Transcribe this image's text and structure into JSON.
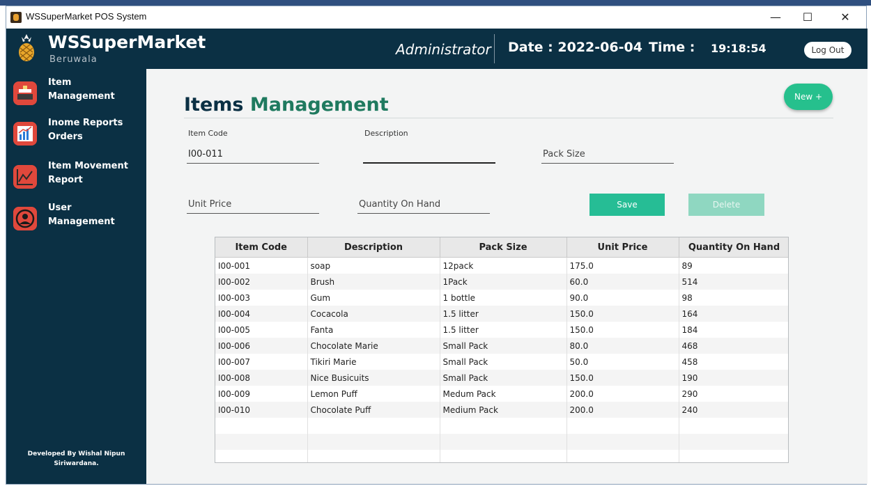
{
  "window": {
    "title": "WSSuperMarket POS System",
    "minimize": "—",
    "maximize": "☐",
    "close": "✕"
  },
  "header": {
    "brand": "WSSuperMarket",
    "branch": "Beruwala",
    "role": "Administrator",
    "date_label": "Date : 2022-06-04",
    "time_label": "Time :",
    "time_value": "19:18:54",
    "logout_label": "Log Out"
  },
  "sidebar": {
    "items": [
      {
        "line1": "Item",
        "line2": "Management",
        "icon": "cash-register-icon"
      },
      {
        "line1": "Inome Reports",
        "line2": "Orders",
        "icon": "bar-chart-icon"
      },
      {
        "line1": "Item Movement",
        "line2": "Report",
        "icon": "line-chart-icon"
      },
      {
        "line1": "User",
        "line2": "Management",
        "icon": "user-icon"
      }
    ],
    "developer_line1": "Developed By Wishal Nipun",
    "developer_line2": "Siriwardana."
  },
  "main": {
    "title_part1": "Items",
    "title_part2": "Management",
    "new_button": "New +",
    "form": {
      "item_code_label": "Item Code",
      "item_code_value": "I00-011",
      "description_label": "Description",
      "description_value": "",
      "pack_size_placeholder": "Pack Size",
      "unit_price_placeholder": "Unit Price",
      "qty_placeholder": "Quantity On Hand"
    },
    "save_button": "Save",
    "delete_button": "Delete",
    "table": {
      "columns": [
        "Item Code",
        "Description",
        "Pack Size",
        "Unit Price",
        "Quantity On Hand"
      ],
      "rows": [
        [
          "I00-001",
          "soap",
          "12pack",
          "175.0",
          "89"
        ],
        [
          "I00-002",
          "Brush",
          "1Pack",
          "60.0",
          "514"
        ],
        [
          "I00-003",
          "Gum",
          "1 bottle",
          "90.0",
          "98"
        ],
        [
          "I00-004",
          "Cocacola",
          "1.5 litter",
          "150.0",
          "164"
        ],
        [
          "I00-005",
          "Fanta",
          "1.5 litter",
          "150.0",
          "184"
        ],
        [
          "I00-006",
          "Chocolate Marie",
          "Small Pack",
          "80.0",
          "468"
        ],
        [
          "I00-007",
          "Tikiri Marie",
          "Small Pack",
          "50.0",
          "458"
        ],
        [
          "I00-008",
          "Nice Busicuits",
          "Small Pack",
          "150.0",
          "190"
        ],
        [
          "I00-009",
          "Lemon Puff",
          "Medum Pack",
          "200.0",
          "290"
        ],
        [
          "I00-010",
          "Chocolate Puff",
          "Medium Pack",
          "200.0",
          "240"
        ]
      ]
    }
  },
  "colors": {
    "navy": "#0b3044",
    "accent_green": "#26c08d",
    "title_green": "#1f7a5f"
  }
}
